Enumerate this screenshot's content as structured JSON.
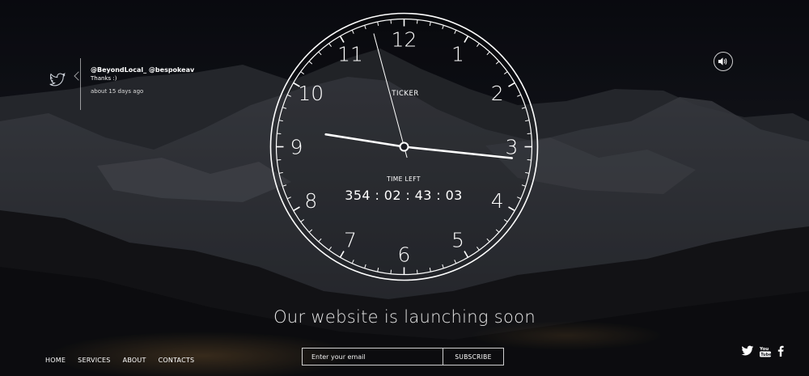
{
  "tweet": {
    "handles": "@BeyondLocal_ @bespokeav",
    "text": "Thanks :)",
    "time": "about 15 days ago"
  },
  "clock": {
    "brand": "TICKER",
    "time_left_label": "TIME LEFT",
    "countdown": "354 : 02 : 43 : 03",
    "numerals": [
      "12",
      "1",
      "2",
      "3",
      "4",
      "5",
      "6",
      "7",
      "8",
      "9",
      "10",
      "11"
    ],
    "hands": {
      "hour": 9.3,
      "minute": 16,
      "second": 57.5
    }
  },
  "tagline": "Our website is launching soon",
  "nav": [
    "HOME",
    "SERVICES",
    "ABOUT",
    "CONTACTS"
  ],
  "subscribe": {
    "placeholder": "Enter your email",
    "button": "SUBSCRIBE"
  },
  "icons": {
    "tweet": "twitter-icon",
    "sound": "speaker-icon",
    "social": [
      "twitter-icon",
      "youtube-icon",
      "facebook-icon"
    ]
  },
  "colors": {
    "background": "#14161c",
    "foreground": "#ffffff"
  }
}
